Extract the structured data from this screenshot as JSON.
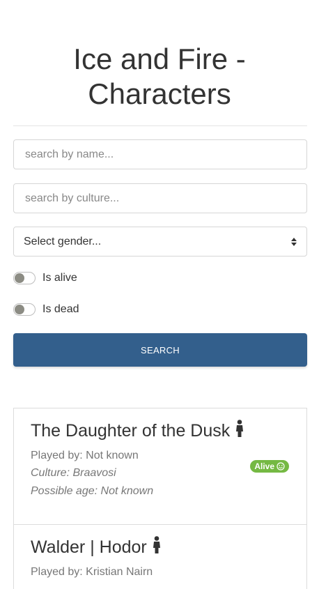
{
  "header": {
    "title": "Ice and Fire - Characters"
  },
  "filters": {
    "name_placeholder": "search by name...",
    "culture_placeholder": "search by culture...",
    "gender_select": "Select gender...",
    "alive_label": "Is alive",
    "dead_label": "Is dead",
    "search_label": "SEARCH"
  },
  "characters": [
    {
      "name": "The Daughter of the Dusk",
      "played_by": "Played by: Not known",
      "culture": "Culture: Braavosi",
      "age": "Possible age: Not known",
      "status": "Alive",
      "gender_icon": "person-icon"
    },
    {
      "name": "Walder | Hodor",
      "played_by": "Played by: Kristian Nairn",
      "gender_icon": "person-icon"
    }
  ],
  "colors": {
    "primary": "#335f8c",
    "alive": "#75b943"
  }
}
